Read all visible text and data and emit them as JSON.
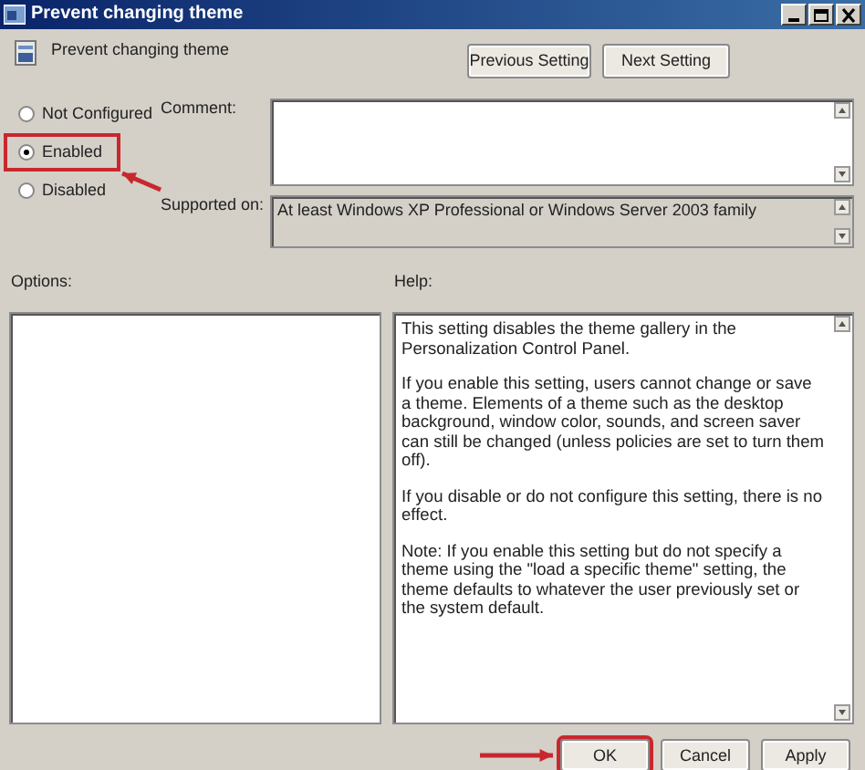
{
  "window": {
    "title": "Prevent changing theme"
  },
  "setting_name": "Prevent changing theme",
  "nav_buttons": [
    "Previous Setting",
    "Next Setting"
  ],
  "states": [
    {
      "label": "Not Configured",
      "selected": false,
      "annotated": false
    },
    {
      "label": "Enabled",
      "selected": true,
      "annotated": true
    },
    {
      "label": "Disabled",
      "selected": false,
      "annotated": false
    }
  ],
  "comment": {
    "label": "Comment:"
  },
  "supported_on": {
    "label": "Supported on:",
    "value": "At least Windows XP Professional or Windows Server 2003 family"
  },
  "options": {
    "label": "Options:"
  },
  "help": {
    "label": "Help:",
    "paragraphs": [
      "This setting disables the theme gallery in the Personalization Control Panel.",
      "If you enable this setting, users cannot change or save a theme. Elements of a theme such as the desktop background, window color, sounds, and screen saver can still be changed (unless policies are set to turn them off).",
      "If you disable or do not configure this setting, there is no effect.",
      "Note: If you enable this setting but do not specify a theme using the \"load a specific theme\" setting, the theme defaults to whatever the user previously set or the system default."
    ]
  },
  "buttons": [
    {
      "label": "OK",
      "annotated": true
    },
    {
      "label": "Cancel",
      "annotated": false
    },
    {
      "label": "Apply",
      "annotated": false
    }
  ]
}
